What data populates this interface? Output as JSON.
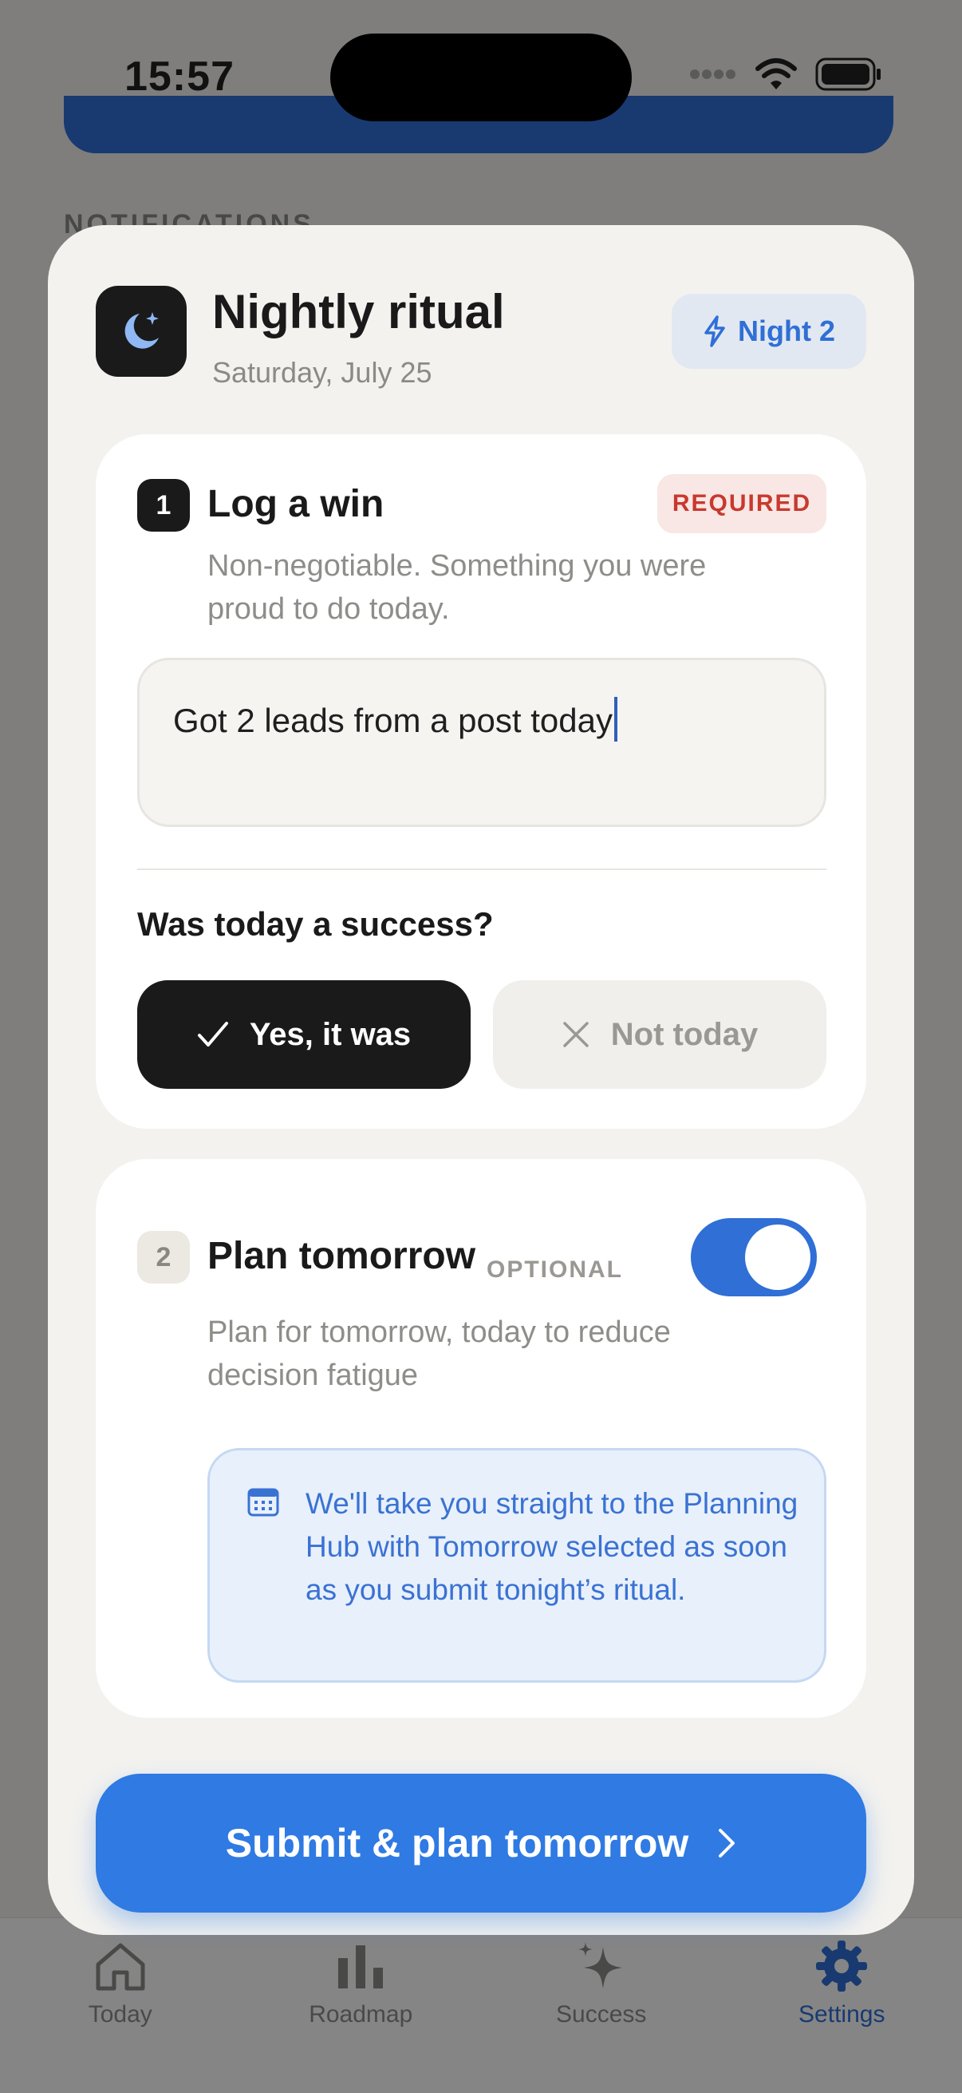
{
  "status_bar": {
    "time": "15:57"
  },
  "background": {
    "section_label": "NOTIFICATIONS",
    "tabs": [
      {
        "label": "Today",
        "icon": "home-icon"
      },
      {
        "label": "Roadmap",
        "icon": "bar-chart-icon"
      },
      {
        "label": "Success",
        "icon": "sparkle-icon"
      },
      {
        "label": "Settings",
        "icon": "gear-icon",
        "active": true
      }
    ]
  },
  "sheet": {
    "title": "Nightly ritual",
    "date": "Saturday, July 25",
    "night_badge": "Night 2",
    "step1": {
      "number": "1",
      "title": "Log a win",
      "badge": "REQUIRED",
      "description": "Non-negotiable. Something you were proud to do today.",
      "input_value": "Got 2 leads from a post today",
      "question": "Was today a success?",
      "yes_label": "Yes, it was",
      "no_label": "Not today",
      "selected": "yes"
    },
    "step2": {
      "number": "2",
      "title": "Plan tomorrow",
      "badge": "OPTIONAL",
      "toggle_on": true,
      "description": "Plan for tomorrow, today to reduce decision fatigue",
      "info": "We'll take you straight to the Planning Hub with Tomorrow selected as soon as you submit tonight’s ritual."
    },
    "submit_label": "Submit & plan tomorrow"
  },
  "colors": {
    "accent": "#2f7ae3",
    "required": "#c8392e",
    "dark": "#1a1a1a"
  }
}
